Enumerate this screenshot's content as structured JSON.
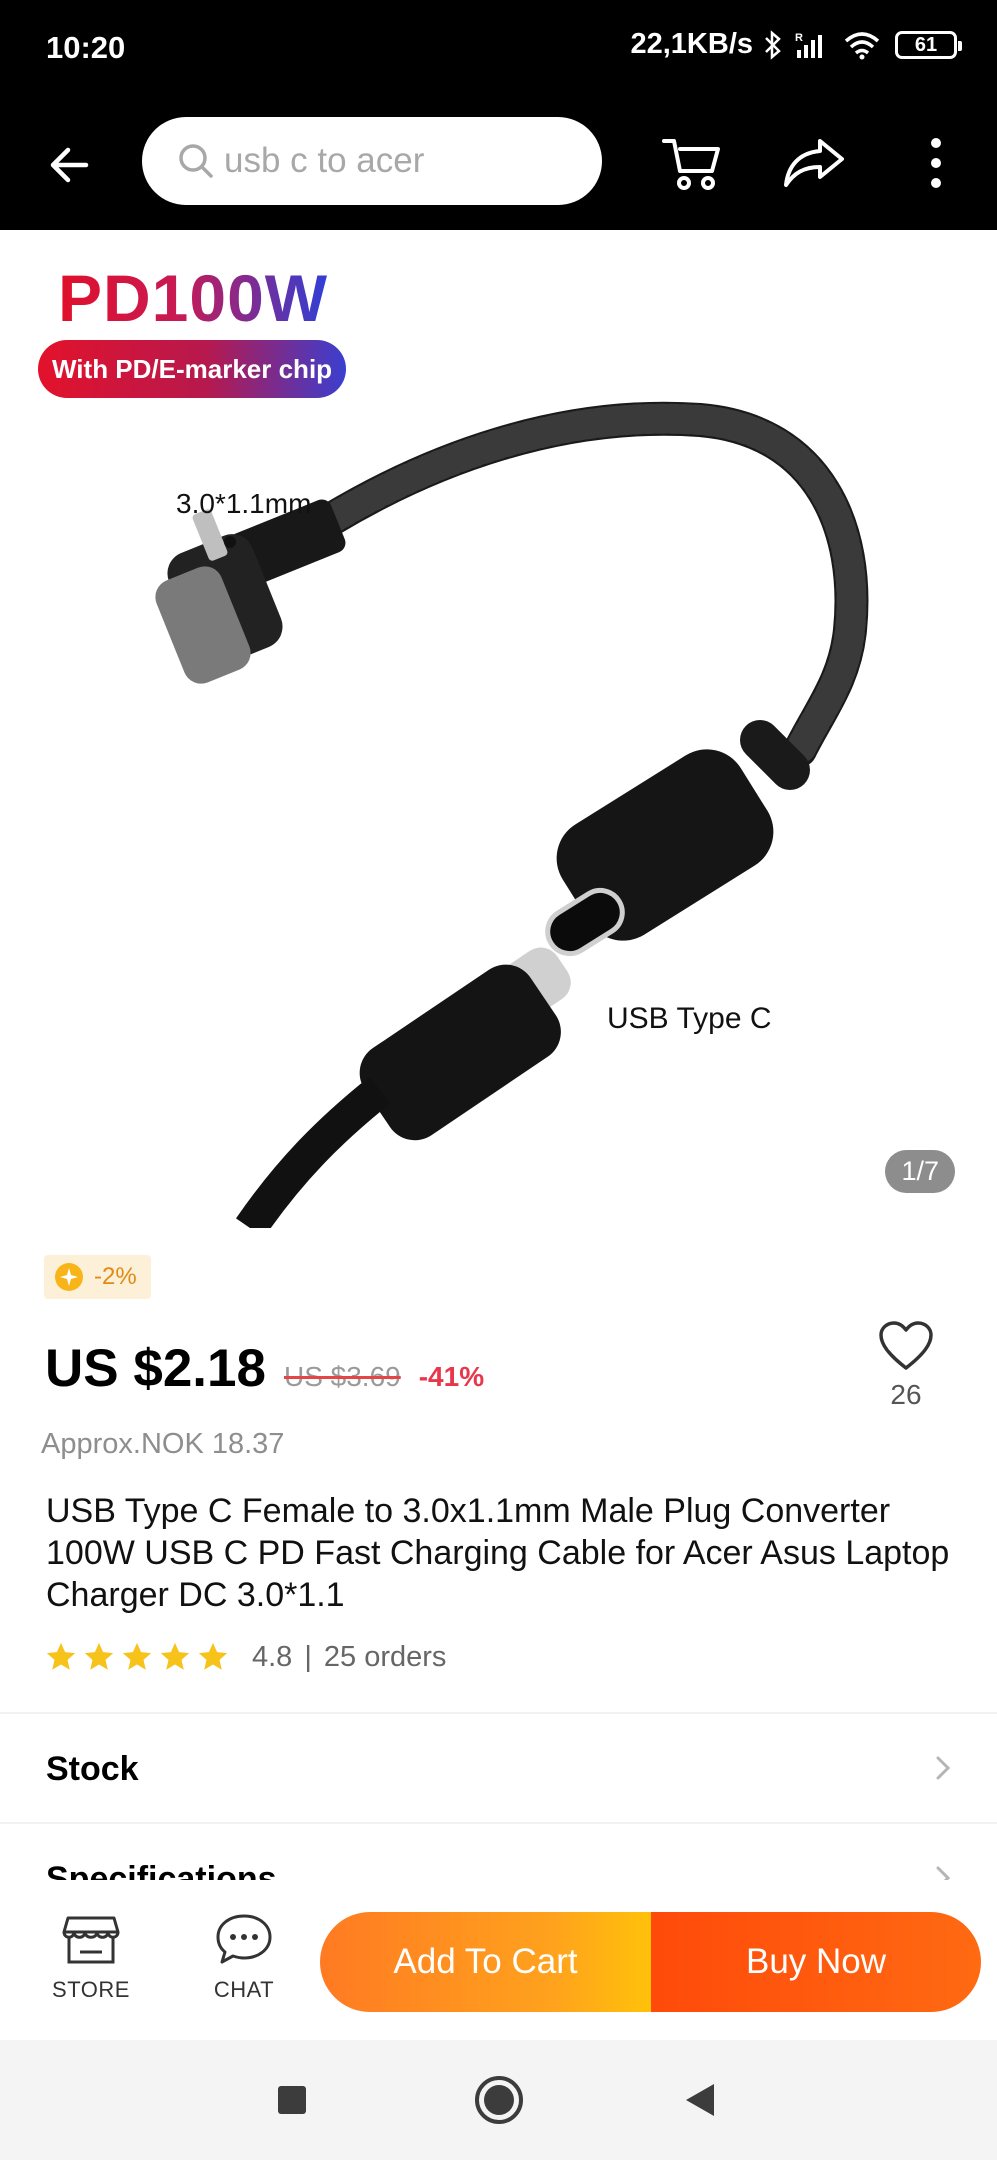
{
  "status_bar": {
    "time": "10:20",
    "net_speed": "22,1KB/s",
    "battery": "61"
  },
  "search": {
    "placeholder": "usb c to acer"
  },
  "gallery": {
    "headline": "PD100W",
    "chip_label": "With PD/E-marker chip",
    "dc_label": "3.0*1.1mm",
    "usbc_label": "USB Type C",
    "page_indicator": "1/7"
  },
  "product": {
    "coin_discount": "-2%",
    "price": "US $2.18",
    "original_price": "US $3.69",
    "discount": "-41%",
    "wishlist_count": "26",
    "approx_price": "Approx.NOK 18.37",
    "title": "USB Type C Female to 3.0x1.1mm Male Plug Converter 100W USB C PD Fast Charging Cable for Acer Asus Laptop Charger DC 3.0*1.1",
    "rating": "4.8",
    "rating_separator": "|",
    "orders": "25 orders",
    "stars": 5
  },
  "sections": {
    "stock_label": "Stock",
    "specs_label": "Specifications"
  },
  "action_bar": {
    "store_label": "STORE",
    "chat_label": "CHAT",
    "add_to_cart_label": "Add To Cart",
    "buy_now_label": "Buy Now"
  },
  "colors": {
    "accent_orange": "#ff7a22",
    "accent_red": "#ff4a0a",
    "discount_red": "#e8364a",
    "star_yellow": "#f7c21a"
  },
  "icons": {
    "back": "arrow-left-icon",
    "search": "search-icon",
    "cart": "cart-icon",
    "share": "share-icon",
    "more": "more-vertical-icon",
    "wishlist": "heart-icon",
    "coin": "coin-icon",
    "store": "store-icon",
    "chat": "chat-icon"
  }
}
